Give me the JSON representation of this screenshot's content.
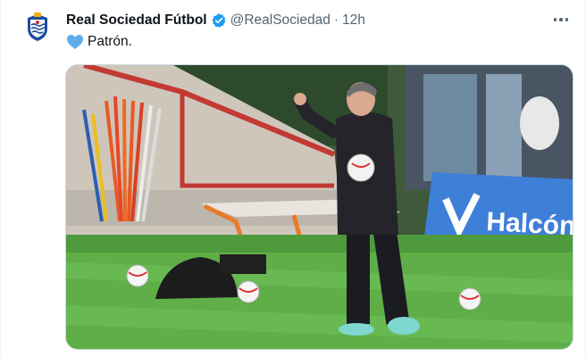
{
  "tweet": {
    "author_name": "Real Sociedad Fútbol",
    "handle": "@RealSociedad",
    "separator": "·",
    "time": "12h",
    "text": "Patrón.",
    "verified": true
  },
  "media": {
    "banner_text": "Halcón"
  },
  "icons": {
    "avatar": "real-sociedad-crest",
    "verified": "verified-badge-icon",
    "heart": "blue-heart-emoji",
    "more": "more-options-icon"
  },
  "colors": {
    "verified_blue": "#1d9bf0",
    "heart_blue": "#5dadec",
    "muted_text": "#536471",
    "banner_blue": "#3e7fd8"
  }
}
